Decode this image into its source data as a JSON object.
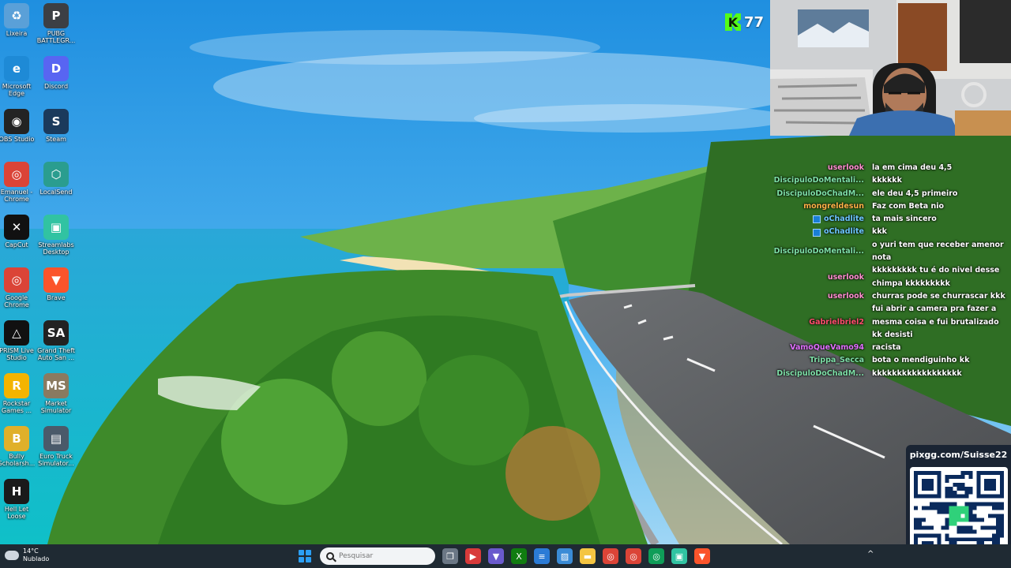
{
  "desktop_icons": [
    {
      "label": "Lixeira",
      "icon": "recycle-bin-icon",
      "color": "#5aa0d8",
      "glyph": "♻"
    },
    {
      "label": "PUBG BATTLEGR...",
      "icon": "pubg-icon",
      "color": "#3c3f44",
      "glyph": "P"
    },
    {
      "label": "Microsoft Edge",
      "icon": "edge-icon",
      "color": "#1e8ad6",
      "glyph": "e"
    },
    {
      "label": "Discord",
      "icon": "discord-icon",
      "color": "#5865f2",
      "glyph": "D"
    },
    {
      "label": "OBS Studio",
      "icon": "obs-icon",
      "color": "#232323",
      "glyph": "◉"
    },
    {
      "label": "Steam",
      "icon": "steam-icon",
      "color": "#1b3a5c",
      "glyph": "S"
    },
    {
      "label": "Emanuel - Chrome",
      "icon": "chrome-icon",
      "color": "#db4437",
      "glyph": "◎"
    },
    {
      "label": "LocalSend",
      "icon": "localsend-icon",
      "color": "#2a9d8f",
      "glyph": "⬡"
    },
    {
      "label": "CapCut",
      "icon": "capcut-icon",
      "color": "#111111",
      "glyph": "✕"
    },
    {
      "label": "Streamlabs Desktop",
      "icon": "streamlabs-icon",
      "color": "#31c3a2",
      "glyph": "▣"
    },
    {
      "label": "Google Chrome",
      "icon": "chrome-icon",
      "color": "#db4437",
      "glyph": "◎"
    },
    {
      "label": "Brave",
      "icon": "brave-icon",
      "color": "#fb542b",
      "glyph": "▼"
    },
    {
      "label": "PRISM Live Studio",
      "icon": "prism-icon",
      "color": "#111111",
      "glyph": "△"
    },
    {
      "label": "Grand Theft Auto San ...",
      "icon": "gta-sa-icon",
      "color": "#222222",
      "glyph": "SA"
    },
    {
      "label": "Rockstar Games ...",
      "icon": "rockstar-icon",
      "color": "#f4b400",
      "glyph": "R"
    },
    {
      "label": "Market Simulator",
      "icon": "market-simulator-icon",
      "color": "#8a7a60",
      "glyph": "MS"
    },
    {
      "label": "Bully Scholarsh...",
      "icon": "bully-icon",
      "color": "#e0b02a",
      "glyph": "B"
    },
    {
      "label": "Euro Truck Simulator...",
      "icon": "euro-truck-icon",
      "color": "#4a5a6a",
      "glyph": "▤"
    },
    {
      "label": "Hell Let Loose",
      "icon": "hell-let-loose-icon",
      "color": "#1a1a1a",
      "glyph": "H"
    }
  ],
  "stream": {
    "kick_count": "77",
    "kick_color": "#53fc18",
    "pix_url": "pixgg.com/Suisse22"
  },
  "chat": [
    {
      "user": "userlook",
      "color": "#ff8ed0",
      "badge": false,
      "message": "la em cima deu 4,5"
    },
    {
      "user": "DiscipuloDoMentali...",
      "color": "#7ee0a8",
      "badge": false,
      "message": "kkkkkk"
    },
    {
      "user": "DiscipuloDoChadM...",
      "color": "#7ee0a8",
      "badge": false,
      "message": "ele deu 4,5 primeiro"
    },
    {
      "user": "mongreldesun",
      "color": "#ffb347",
      "badge": false,
      "message": "Faz com Beta nio"
    },
    {
      "user": "oChadlite",
      "color": "#6cc6ff",
      "badge": true,
      "message": "ta mais sincero"
    },
    {
      "user": "oChadlite",
      "color": "#6cc6ff",
      "badge": true,
      "message": "kkk"
    },
    {
      "user": "DiscipuloDoMentali...",
      "color": "#7ee0a8",
      "badge": false,
      "message": "o yuri tem que receber amenor nota"
    },
    {
      "user": "userlook",
      "color": "#ff8ed0",
      "badge": false,
      "message": "kkkkkkkkk tu é do nivel desse chimpa kkkkkkkkk"
    },
    {
      "user": "userlook",
      "color": "#ff8ed0",
      "badge": false,
      "message": "churras pode se churrascar kkk"
    },
    {
      "user": "Gabrielbriel2",
      "color": "#ff4d6d",
      "badge": false,
      "message": "fui abrir a camera pra fazer a mesma coisa e fui brutalizado kk desisti"
    },
    {
      "user": "VamoQueVamo94",
      "color": "#e070ff",
      "badge": false,
      "message": "racista"
    },
    {
      "user": "Trippa_Secca",
      "color": "#7ee0a8",
      "badge": false,
      "message": "bota o mendiguinho kk"
    },
    {
      "user": "DiscipuloDoChadM...",
      "color": "#7ee0a8",
      "badge": false,
      "message": "kkkkkkkkkkkkkkkkkk"
    }
  ],
  "taskbar": {
    "weather_temp": "14°C",
    "weather_desc": "Nublado",
    "search_placeholder": "Pesquisar",
    "apps": [
      {
        "icon": "task-view-icon",
        "color": "#6b7785",
        "glyph": "❐"
      },
      {
        "icon": "app-red-icon",
        "color": "#d83a3a",
        "glyph": "▶"
      },
      {
        "icon": "vpn-icon",
        "color": "#6a5acd",
        "glyph": "▼"
      },
      {
        "icon": "xbox-icon",
        "color": "#107c10",
        "glyph": "X"
      },
      {
        "icon": "notepad-icon",
        "color": "#2b7bd6",
        "glyph": "≡"
      },
      {
        "icon": "photos-icon",
        "color": "#3a8bd6",
        "glyph": "▨"
      },
      {
        "icon": "file-explorer-icon",
        "color": "#f4c542",
        "glyph": "▬"
      },
      {
        "icon": "chrome-icon",
        "color": "#db4437",
        "glyph": "◎"
      },
      {
        "icon": "chrome-icon",
        "color": "#db4437",
        "glyph": "◎"
      },
      {
        "icon": "chrome-icon",
        "color": "#0f9d58",
        "glyph": "◎"
      },
      {
        "icon": "streamlabs-icon",
        "color": "#31c3a2",
        "glyph": "▣"
      },
      {
        "icon": "brave-icon",
        "color": "#fb542b",
        "glyph": "▼"
      }
    ],
    "tray_chevron": "^"
  }
}
